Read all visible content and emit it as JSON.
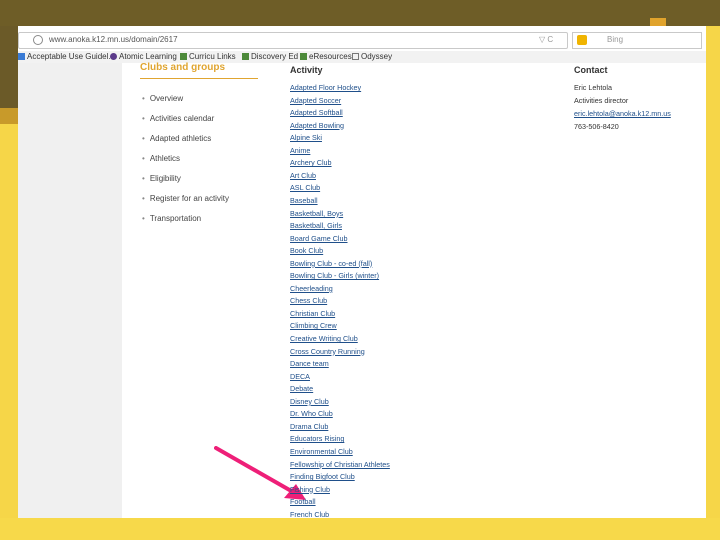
{
  "browser": {
    "url": "www.anoka.k12.mn.us/domain/2617",
    "search_placeholder": "Bing"
  },
  "bookmarks": [
    {
      "label": "Acceptable Use Guidel..."
    },
    {
      "label": "Atomic Learning"
    },
    {
      "label": "Curricu Links"
    },
    {
      "label": "Discovery Ed"
    },
    {
      "label": "eResources"
    },
    {
      "label": "Odyssey"
    }
  ],
  "sidebar": {
    "title": "Clubs and groups",
    "items": [
      {
        "label": "Overview"
      },
      {
        "label": "Activities calendar"
      },
      {
        "label": "Adapted athletics"
      },
      {
        "label": "Athletics"
      },
      {
        "label": "Eligibility"
      },
      {
        "label": "Register for an activity"
      },
      {
        "label": "Transportation"
      }
    ]
  },
  "activity": {
    "heading": "Activity",
    "items": [
      "Adapted Floor Hockey",
      "Adapted Soccer",
      "Adapted Softball",
      "Adapted Bowling",
      "Alpine Ski",
      "Anime",
      "Archery Club",
      "Art Club",
      "ASL Club",
      "Baseball",
      "Basketball, Boys",
      "Basketball, Girls",
      "Board Game Club",
      "Book Club",
      "Bowling Club - co-ed (fall)",
      "Bowling Club - Girls (winter)",
      "Cheerleading",
      "Chess Club",
      "Christian Club",
      "Climbing Crew",
      "Creative Writing Club",
      "Cross Country Running",
      "Dance team",
      "DECA",
      "Debate",
      "Disney Club",
      "Dr. Who Club",
      "Drama Club",
      "Educators Rising",
      "Environmental Club",
      "Fellowship of Christian Athletes",
      "Finding Bigfoot Club",
      "Fishing Club",
      "Football",
      "French Club"
    ]
  },
  "contact": {
    "heading": "Contact",
    "name": "Eric Lehtola",
    "title": "Activities director",
    "email": "eric.lehtola@anoka.k12.mn.us",
    "phone": "763-506-8420"
  },
  "colors": {
    "accent": "#e0a530",
    "link": "#1f4f8a",
    "arrow": "#ee1f78",
    "slide_yellow": "#f6d648"
  }
}
